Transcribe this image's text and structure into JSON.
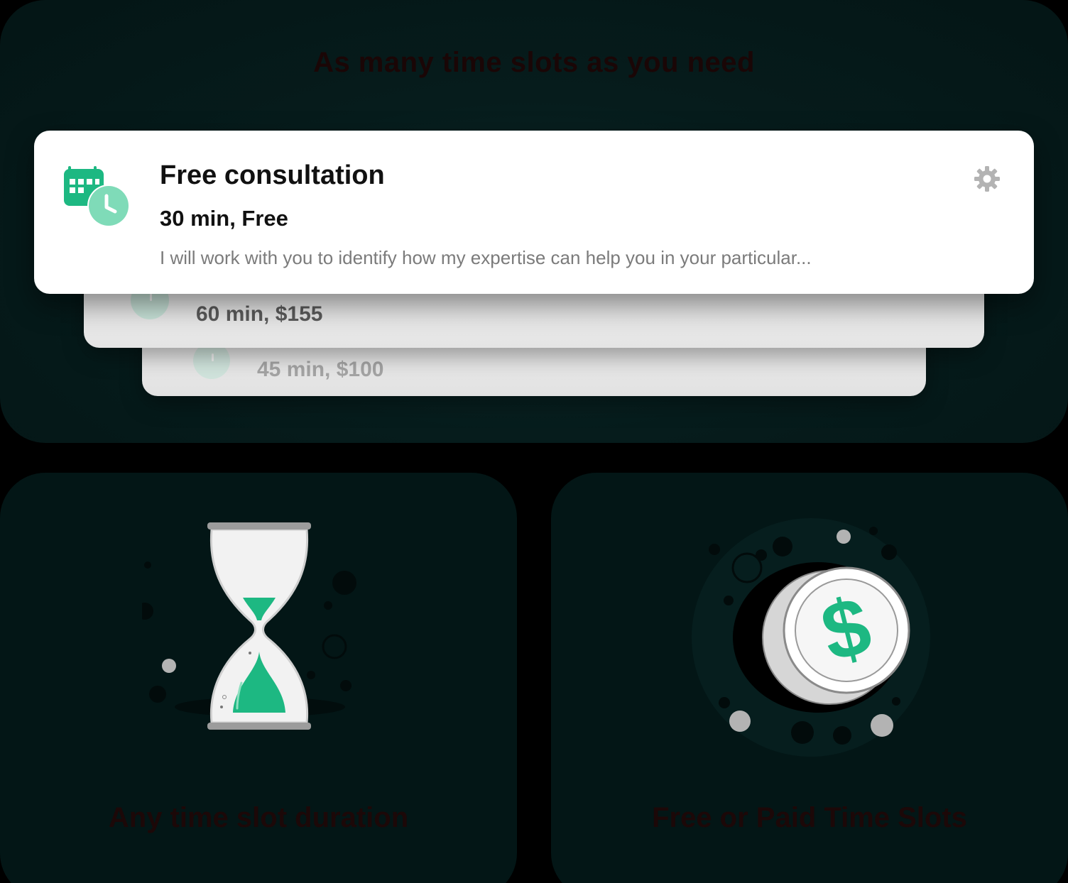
{
  "top_section": {
    "heading": "As many time slots as you need",
    "front_card": {
      "title": "Free consultation",
      "subtitle": "30 min, Free",
      "description": "I will work with you to identify how my expertise can help you in your particular...",
      "icon": "calendar-clock-icon",
      "settings_icon": "gear-icon"
    },
    "back_cards": [
      {
        "price": "60 min, $155"
      },
      {
        "price": "45 min, $100"
      }
    ]
  },
  "bottom_left": {
    "caption": "Any time slot duration",
    "illustration": "hourglass-icon"
  },
  "bottom_right": {
    "caption": "Free or Paid Time Slots",
    "illustration": "dollar-coin-icon"
  },
  "colors": {
    "accent_green": "#1db882",
    "light_green": "#7fdbb8",
    "panel_dark": "#041515"
  }
}
